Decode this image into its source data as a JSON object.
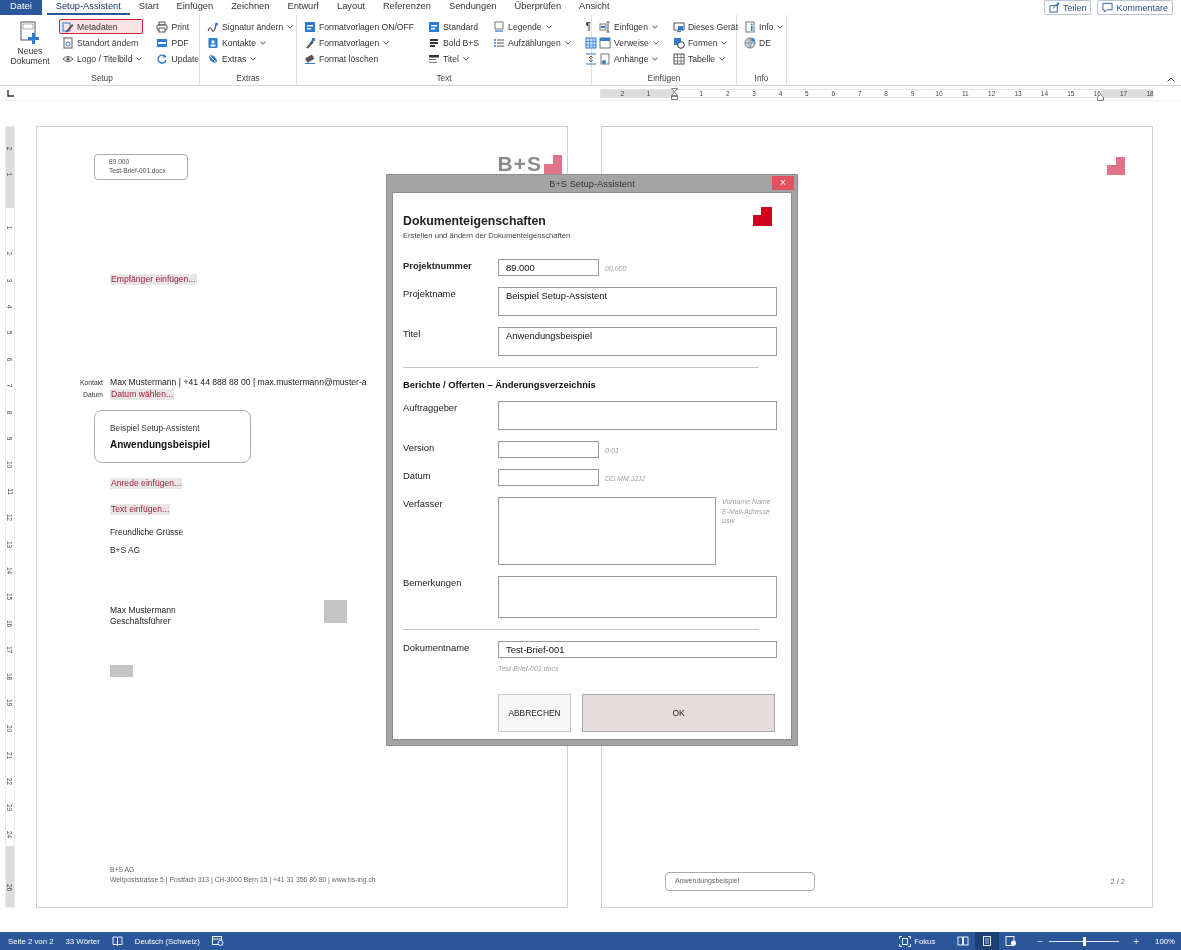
{
  "tabs": [
    {
      "label": "Datei",
      "kind": "file",
      "selected": false
    },
    {
      "label": "Setup-Assistent",
      "kind": "tab",
      "selected": true
    },
    {
      "label": "Start",
      "kind": "tab",
      "selected": false
    },
    {
      "label": "Einfügen",
      "kind": "tab",
      "selected": false
    },
    {
      "label": "Zeichnen",
      "kind": "tab",
      "selected": false
    },
    {
      "label": "Entwurf",
      "kind": "tab",
      "selected": false
    },
    {
      "label": "Layout",
      "kind": "tab",
      "selected": false
    },
    {
      "label": "Referenzen",
      "kind": "tab",
      "selected": false
    },
    {
      "label": "Sendungen",
      "kind": "tab",
      "selected": false
    },
    {
      "label": "Überprüfen",
      "kind": "tab",
      "selected": false
    },
    {
      "label": "Ansicht",
      "kind": "tab",
      "selected": false
    }
  ],
  "top_buttons": [
    {
      "label": "Teilen"
    },
    {
      "label": "Kommentare"
    }
  ],
  "ribbon": [
    {
      "label": "Setup",
      "columns": [
        [
          {
            "kind": "large",
            "label": "Neues Dokument",
            "dropdown": false,
            "highlighted": false
          }
        ],
        [
          {
            "kind": "small",
            "label": "Metadaten",
            "dropdown": false,
            "highlighted": true
          },
          {
            "kind": "small",
            "label": "Standort ändern",
            "dropdown": false,
            "highlighted": false
          },
          {
            "kind": "small",
            "label": "Logo / Titelbild",
            "dropdown": true,
            "highlighted": false
          }
        ],
        [
          {
            "kind": "small",
            "label": "Print",
            "dropdown": false,
            "highlighted": false
          },
          {
            "kind": "small",
            "label": "PDF",
            "dropdown": false,
            "highlighted": false
          },
          {
            "kind": "small",
            "label": "Update",
            "dropdown": false,
            "highlighted": false
          }
        ]
      ]
    },
    {
      "label": "Extras",
      "columns": [
        [
          {
            "kind": "small",
            "label": "Signatur ändern",
            "dropdown": true,
            "highlighted": false
          },
          {
            "kind": "small",
            "label": "Kontakte",
            "dropdown": true,
            "highlighted": false
          },
          {
            "kind": "small",
            "label": "Extras",
            "dropdown": true,
            "highlighted": false
          }
        ]
      ]
    },
    {
      "label": "Text",
      "columns": [
        [
          {
            "kind": "small",
            "label": "Formatvorlagen ON/OFF",
            "dropdown": false,
            "highlighted": false
          },
          {
            "kind": "small",
            "label": "Formatvorlagen",
            "dropdown": true,
            "highlighted": false
          },
          {
            "kind": "small",
            "label": "Format löschen",
            "dropdown": false,
            "highlighted": false
          }
        ],
        [
          {
            "kind": "small",
            "label": "Standard",
            "dropdown": false,
            "highlighted": false
          },
          {
            "kind": "small",
            "label": "Bold B+S",
            "dropdown": false,
            "highlighted": false
          },
          {
            "kind": "small",
            "label": "Titel",
            "dropdown": true,
            "highlighted": false
          }
        ],
        [
          {
            "kind": "small",
            "label": "Legende",
            "dropdown": true,
            "highlighted": false
          },
          {
            "kind": "small",
            "label": "Aufzählungen",
            "dropdown": true,
            "highlighted": false
          }
        ],
        [
          {
            "kind": "glyph",
            "label": "¶",
            "dropdown": false,
            "highlighted": false
          },
          {
            "kind": "icon",
            "dropdown": false,
            "highlighted": false
          },
          {
            "kind": "icon",
            "dropdown": false,
            "highlighted": false
          }
        ]
      ]
    },
    {
      "label": "Einfügen",
      "columns": [
        [
          {
            "kind": "small",
            "label": "Einfügen",
            "dropdown": true,
            "highlighted": false
          },
          {
            "kind": "small",
            "label": "Verweise",
            "dropdown": true,
            "highlighted": false
          },
          {
            "kind": "small",
            "label": "Anhänge",
            "dropdown": true,
            "highlighted": false
          }
        ],
        [
          {
            "kind": "small",
            "label": "Dieses Gerät",
            "dropdown": false,
            "highlighted": false
          },
          {
            "kind": "small",
            "label": "Formen",
            "dropdown": true,
            "highlighted": false
          },
          {
            "kind": "small",
            "label": "Tabelle",
            "dropdown": true,
            "highlighted": false
          }
        ]
      ]
    },
    {
      "label": "Info",
      "columns": [
        [
          {
            "kind": "small",
            "label": "Info",
            "dropdown": true,
            "highlighted": false
          },
          {
            "kind": "small",
            "label": "DE",
            "dropdown": false,
            "highlighted": false
          }
        ]
      ]
    }
  ],
  "ruler": {
    "left_labels": [
      "2",
      "1"
    ],
    "labels": [
      "1",
      "2",
      "3",
      "4",
      "5",
      "6",
      "7",
      "8",
      "9",
      "10",
      "11",
      "12",
      "13",
      "14",
      "15",
      "16",
      "17",
      "18"
    ]
  },
  "vertical_ruler": {
    "top_labels": [
      "2",
      "1"
    ],
    "labels": [
      "1",
      "2",
      "3",
      "4",
      "5",
      "6",
      "7",
      "8",
      "9",
      "10",
      "11",
      "12",
      "13",
      "14",
      "15",
      "16",
      "17",
      "18",
      "19",
      "20",
      "21",
      "22",
      "23",
      "24"
    ],
    "bottom_labels": [
      "26"
    ]
  },
  "letter_page": {
    "header_box": [
      "89.000",
      "Test-Brief-001.docx"
    ],
    "logo": "B+S",
    "recipient": "Empfänger einfügen...",
    "contact_rows": [
      {
        "label": "Kontakt",
        "value": "Max Mustermann | +41 44 888 88 00 | max.mustermann@muster-a",
        "kind": "text"
      },
      {
        "label": "Datum",
        "value": "Datum wählen...",
        "kind": "placeholder"
      }
    ],
    "subject_box": {
      "line": "Beispiel Setup-Assistent",
      "title": "Anwendungsbeispiel"
    },
    "paragraphs": [
      {
        "kind": "placeholder",
        "text": "Anrede einfügen..."
      },
      {
        "kind": "placeholder",
        "text": "Text einfügen..."
      },
      {
        "kind": "text",
        "text": "Freundliche Grüsse"
      },
      {
        "kind": "text",
        "text": "B+S AG"
      }
    ],
    "signer": [
      "Max Mustermann",
      "Geschäftsführer"
    ],
    "footer": [
      "B+S AG",
      "Weltpoststrasse 5 | Postfach 313 | CH-3000 Bern 15 | +41 31 356 80 80 | www.bs-ing.ch"
    ]
  },
  "second_page": {
    "footer_box": "Anwendungsbeispiel",
    "page_number": "2 / 2"
  },
  "dialog": {
    "title": "B+S Setup-Assistent",
    "close": "×",
    "heading": "Dokumenteigenschaften",
    "subtitle": "Erstellen und ändern der Dokumenteigenschaften",
    "sections": [
      {
        "fields": [
          {
            "label": "Projektnummer",
            "kind": "short",
            "value": "89.000",
            "hint": "00.000"
          },
          {
            "label": "Projektname",
            "kind": "area",
            "value": "Beispiel Setup-Assistent"
          },
          {
            "label": "Titel",
            "kind": "area",
            "value": "Anwendungsbeispiel"
          }
        ]
      },
      {
        "heading": "Berichte / Offerten  –  Änderungsverzeichnis",
        "fields": [
          {
            "label": "Auftraggeber",
            "kind": "area"
          },
          {
            "label": "Version",
            "kind": "short",
            "hint": "0-01"
          },
          {
            "label": "Datum",
            "kind": "short",
            "hint": "DD.MM.JJJJ"
          },
          {
            "label": "Verfasser",
            "kind": "note",
            "hint_lines": [
              "Vorname Name",
              "E-Mail-Adresse",
              "usw."
            ]
          },
          {
            "label": "Bemerkungen",
            "kind": "memo"
          }
        ]
      },
      {
        "fields": [
          {
            "label": "Dokumentname",
            "kind": "wide",
            "value": "Test-Brief-001",
            "hint": "Test-Brief-001.docx"
          }
        ]
      }
    ],
    "buttons": [
      {
        "label": "ABBRECHEN",
        "kind": "secondary"
      },
      {
        "label": "OK",
        "kind": "primary"
      }
    ]
  },
  "status_bar": {
    "page": "Seite 2 von 2",
    "words": "33 Wörter",
    "language": "Deutsch (Schweiz)",
    "focus": "Fokus",
    "views": [
      {
        "selected": false
      },
      {
        "selected": true
      },
      {
        "selected": false
      }
    ],
    "zoom_out": "−",
    "zoom_in": "+",
    "zoom": {
      "level": 0.5
    },
    "zoom_value": "100%"
  }
}
